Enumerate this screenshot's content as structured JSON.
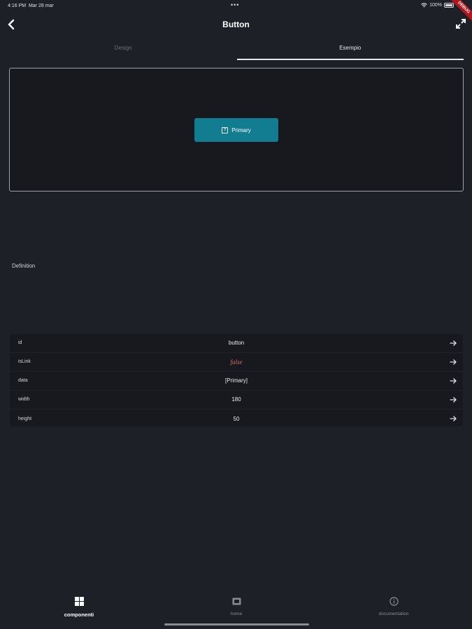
{
  "status_bar": {
    "time": "4:16 PM",
    "date": "Mar 28 mar",
    "dots": "•••",
    "battery": "100%"
  },
  "debug_banner": "DEBUG",
  "header": {
    "title": "Button"
  },
  "tabs": [
    {
      "label": "Design"
    },
    {
      "label": "Esempio"
    }
  ],
  "preview": {
    "button_label": "Primary",
    "button_color": "#127d90"
  },
  "definition_label": "Definition",
  "properties": [
    {
      "key": "id",
      "value": "button"
    },
    {
      "key": "isLink",
      "value": "false"
    },
    {
      "key": "data",
      "value": "[Primary]"
    },
    {
      "key": "width",
      "value": "180"
    },
    {
      "key": "height",
      "value": "50"
    }
  ],
  "bottom_nav": [
    {
      "label": "componenti",
      "icon": "grid-icon"
    },
    {
      "label": "home",
      "icon": "image-icon"
    },
    {
      "label": "documentation",
      "icon": "info-icon"
    }
  ]
}
